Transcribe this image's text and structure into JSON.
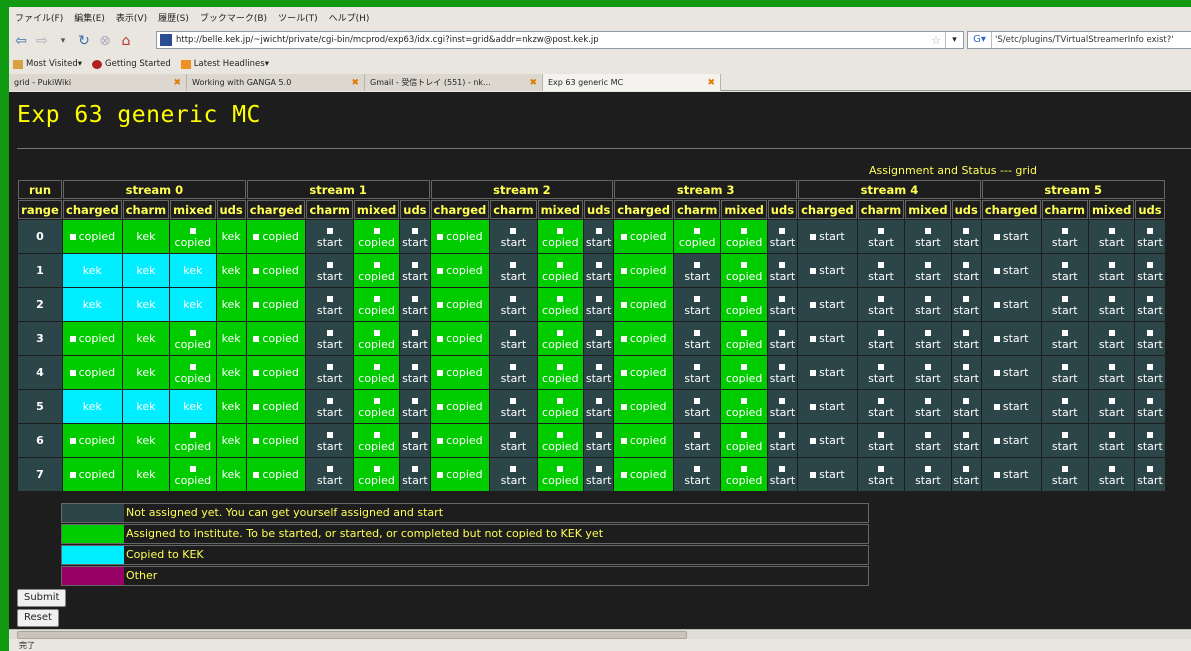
{
  "browser": {
    "menu": [
      "ファイル(F)",
      "編集(E)",
      "表示(V)",
      "履歴(S)",
      "ブックマーク(B)",
      "ツール(T)",
      "ヘルプ(H)"
    ],
    "url": "http://belle.kek.jp/~jwicht/private/cgi-bin/mcprod/exp63/idx.cgi?inst=grid&addr=nkzw@post.kek.jp",
    "search_text": "'S/etc/plugins/TVirtualStreamerInfo exist?'",
    "bookmarks": [
      "Most Visited",
      "Getting Started",
      "Latest Headlines"
    ],
    "tabs": [
      "grid - PukiWiki",
      "Working with GANGA 5.0",
      "Gmail - 受信トレイ (551) - nk...",
      "Exp 63 generic MC"
    ],
    "status": "完了"
  },
  "page": {
    "title": "Exp 63 generic MC",
    "assign_label": "Assignment and Status --- grid",
    "run_header": "run",
    "range_header": "range",
    "streams": [
      "stream 0",
      "stream 1",
      "stream 2",
      "stream 3",
      "stream 4",
      "stream 5"
    ],
    "subcols": [
      "charged",
      "charm",
      "mixed",
      "uds"
    ],
    "rows": [
      {
        "run": "0",
        "cells": [
          "as:copied",
          "as:kek",
          "as:copied-s",
          "as:kek",
          "as:copied",
          "na:start-s",
          "as:copied-s",
          "na:start-s",
          "as:copied",
          "na:start-s",
          "as:copied-s",
          "na:start-s",
          "as:copied",
          "as:copied-s",
          "as:copied-s",
          "na:start-s",
          "na:start",
          "na:start-s",
          "na:start-s",
          "na:start-s",
          "na:start",
          "na:start-s",
          "na:start-s",
          "na:start-s"
        ]
      },
      {
        "run": "1",
        "cells": [
          "cp:kek",
          "cp:kek",
          "cp:kek",
          "as:kek",
          "as:copied",
          "na:start-s",
          "as:copied-s",
          "na:start-s",
          "as:copied",
          "na:start-s",
          "as:copied-s",
          "na:start-s",
          "as:copied",
          "na:start-s",
          "as:copied-s",
          "na:start-s",
          "na:start",
          "na:start-s",
          "na:start-s",
          "na:start-s",
          "na:start",
          "na:start-s",
          "na:start-s",
          "na:start-s"
        ]
      },
      {
        "run": "2",
        "cells": [
          "cp:kek",
          "cp:kek",
          "cp:kek",
          "as:kek",
          "as:copied",
          "na:start-s",
          "as:copied-s",
          "na:start-s",
          "as:copied",
          "na:start-s",
          "as:copied-s",
          "na:start-s",
          "as:copied",
          "na:start-s",
          "as:copied-s",
          "na:start-s",
          "na:start",
          "na:start-s",
          "na:start-s",
          "na:start-s",
          "na:start",
          "na:start-s",
          "na:start-s",
          "na:start-s"
        ]
      },
      {
        "run": "3",
        "cells": [
          "as:copied",
          "as:kek",
          "as:copied-s",
          "as:kek",
          "as:copied",
          "na:start-s",
          "as:copied-s",
          "na:start-s",
          "as:copied",
          "na:start-s",
          "as:copied-s",
          "na:start-s",
          "as:copied",
          "na:start-s",
          "as:copied-s",
          "na:start-s",
          "na:start",
          "na:start-s",
          "na:start-s",
          "na:start-s",
          "na:start",
          "na:start-s",
          "na:start-s",
          "na:start-s"
        ]
      },
      {
        "run": "4",
        "cells": [
          "as:copied",
          "as:kek",
          "as:copied-s",
          "as:kek",
          "as:copied",
          "na:start-s",
          "as:copied-s",
          "na:start-s",
          "as:copied",
          "na:start-s",
          "as:copied-s",
          "na:start-s",
          "as:copied",
          "na:start-s",
          "as:copied-s",
          "na:start-s",
          "na:start",
          "na:start-s",
          "na:start-s",
          "na:start-s",
          "na:start",
          "na:start-s",
          "na:start-s",
          "na:start-s"
        ]
      },
      {
        "run": "5",
        "cells": [
          "cp:kek",
          "cp:kek",
          "cp:kek",
          "as:kek",
          "as:copied",
          "na:start-s",
          "as:copied-s",
          "na:start-s",
          "as:copied",
          "na:start-s",
          "as:copied-s",
          "na:start-s",
          "as:copied",
          "na:start-s",
          "as:copied-s",
          "na:start-s",
          "na:start",
          "na:start-s",
          "na:start-s",
          "na:start-s",
          "na:start",
          "na:start-s",
          "na:start-s",
          "na:start-s"
        ]
      },
      {
        "run": "6",
        "cells": [
          "as:copied",
          "as:kek",
          "as:copied-s",
          "as:kek",
          "as:copied",
          "na:start-s",
          "as:copied-s",
          "na:start-s",
          "as:copied",
          "na:start-s",
          "as:copied-s",
          "na:start-s",
          "as:copied",
          "na:start-s",
          "as:copied-s",
          "na:start-s",
          "na:start",
          "na:start-s",
          "na:start-s",
          "na:start-s",
          "na:start",
          "na:start-s",
          "na:start-s",
          "na:start-s"
        ]
      },
      {
        "run": "7",
        "cells": [
          "as:copied",
          "as:kek",
          "as:copied-s",
          "as:kek",
          "as:copied",
          "na:start-s",
          "as:copied-s",
          "na:start-s",
          "as:copied",
          "na:start-s",
          "as:copied-s",
          "na:start-s",
          "as:copied",
          "na:start-s",
          "as:copied-s",
          "na:start-s",
          "na:start",
          "na:start-s",
          "na:start-s",
          "na:start-s",
          "na:start",
          "na:start-s",
          "na:start-s",
          "na:start-s"
        ]
      }
    ],
    "legend": [
      {
        "color": "#2c4548",
        "text": "Not assigned yet. You can get yourself assigned and start"
      },
      {
        "color": "#00cc00",
        "text": "Assigned to institute. To be started, or started, or completed but not copied to KEK yet"
      },
      {
        "color": "#00eeff",
        "text": "Copied to KEK"
      },
      {
        "color": "#990066",
        "text": "Other"
      }
    ],
    "submit_label": "Submit",
    "reset_label": "Reset"
  },
  "colors": {
    "not_assigned": "#2c4548",
    "assigned": "#00cc00",
    "copied": "#00eeff",
    "other": "#990066",
    "title": "#ffff00"
  }
}
